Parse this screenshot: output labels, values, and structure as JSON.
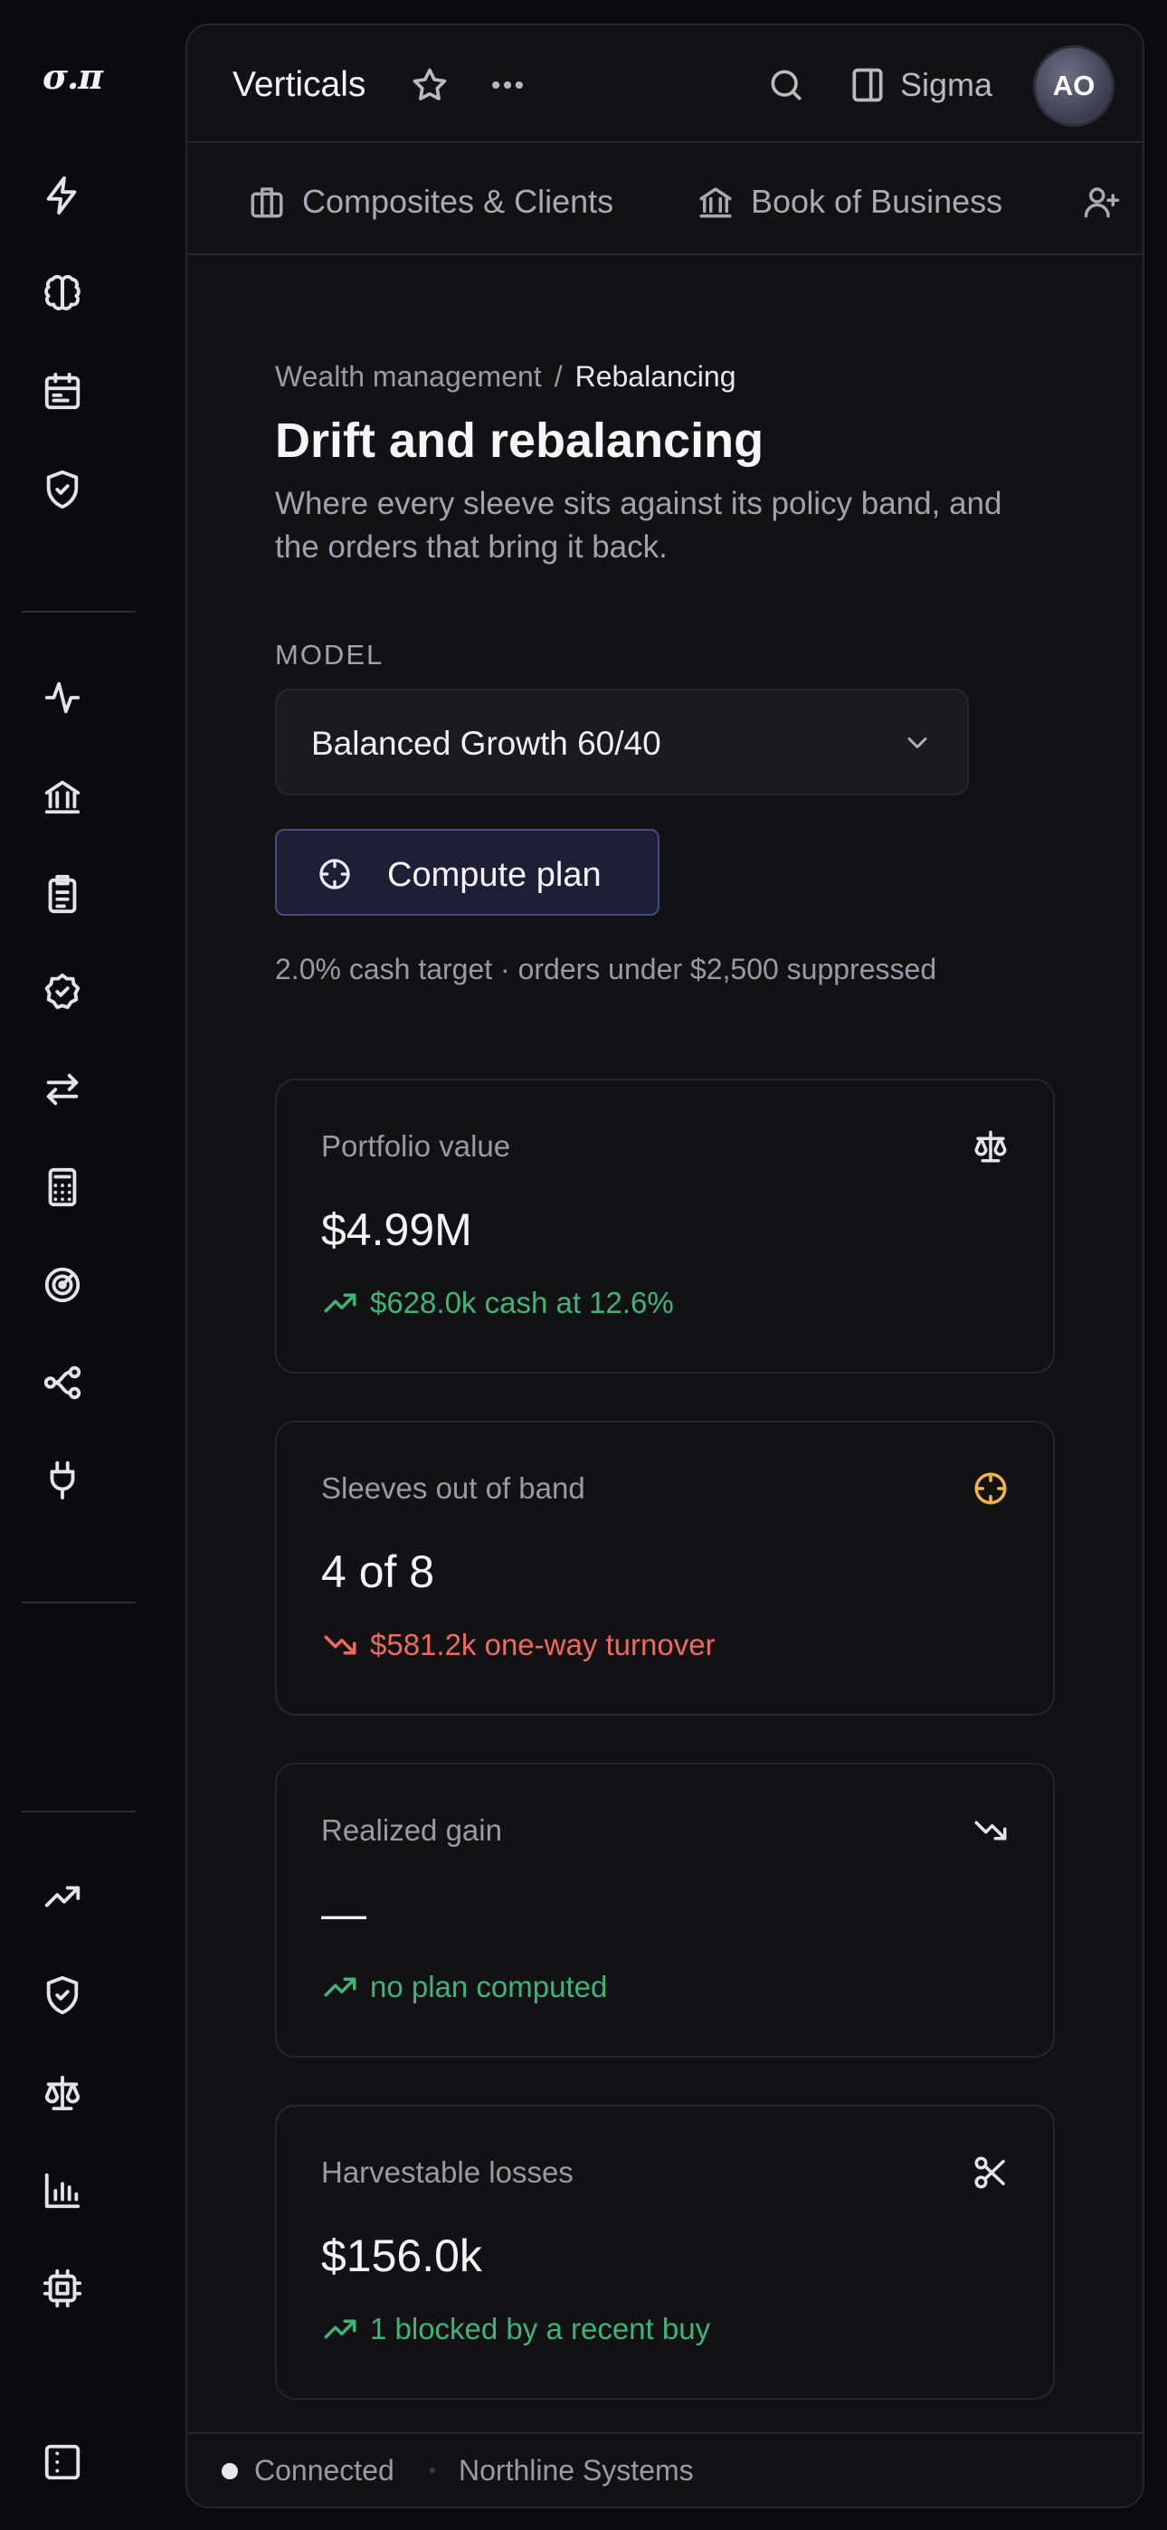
{
  "app": {
    "logo_text": "σ.π"
  },
  "topbar": {
    "title": "Verticals",
    "brand_label": "Sigma",
    "avatar_initials": "AO"
  },
  "tabs": [
    {
      "label": "Composites & Clients",
      "icon": "briefcase-icon"
    },
    {
      "label": "Book of Business",
      "icon": "bank-icon"
    }
  ],
  "breadcrumb": {
    "parent": "Wealth management",
    "separator": "/",
    "current": "Rebalancing"
  },
  "page": {
    "title": "Drift and rebalancing",
    "subtitle": "Where every sleeve sits against its policy band, and the orders that bring it back."
  },
  "model": {
    "label": "MODEL",
    "selected": "Balanced Growth 60/40"
  },
  "compute_button": {
    "label": "Compute plan"
  },
  "note": "2.0% cash target · orders under $2,500 suppressed",
  "cards": [
    {
      "label": "Portfolio value",
      "value": "$4.99M",
      "trend": "$628.0k cash at 12.6%",
      "trend_dir": "up",
      "icon": "scale-icon"
    },
    {
      "label": "Sleeves out of band",
      "value": "4 of 8",
      "trend": "$581.2k one-way turnover",
      "trend_dir": "down",
      "icon": "crosshair-icon"
    },
    {
      "label": "Realized gain",
      "value": "—",
      "trend": "no plan computed",
      "trend_dir": "up",
      "icon": "trending-down-icon"
    },
    {
      "label": "Harvestable losses",
      "value": "$156.0k",
      "trend": "1 blocked by a recent buy",
      "trend_dir": "up",
      "icon": "scissors-icon"
    }
  ],
  "footer": {
    "status": "Connected",
    "org": "Northline Systems"
  },
  "colors": {
    "positive": "#3fb478",
    "negative": "#ef6a5d",
    "warning_icon": "#f2b54a",
    "button_bg": "#1e1e36"
  }
}
